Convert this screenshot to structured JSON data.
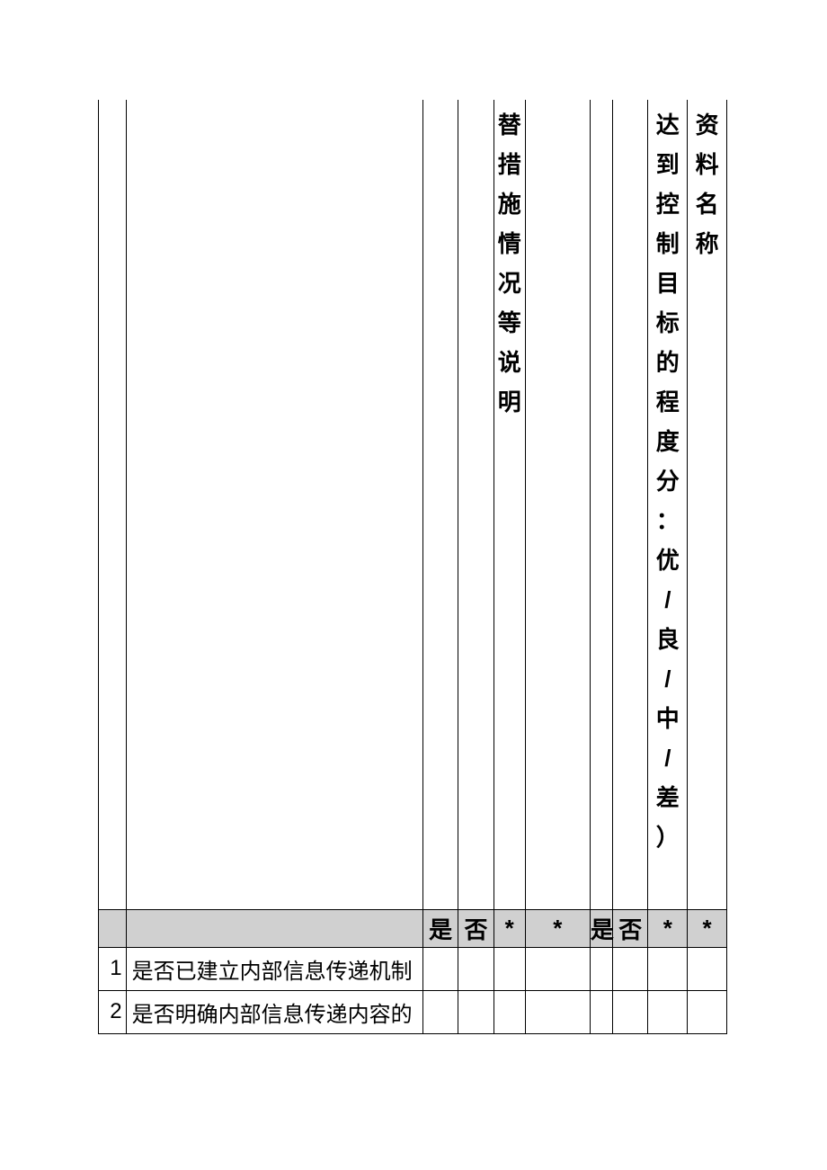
{
  "headers": {
    "verticalA": [
      "替",
      "措",
      "施",
      "情",
      "况",
      "等",
      "说",
      "明"
    ],
    "verticalB": [
      "达",
      "到",
      "控",
      "制",
      "目",
      "标",
      "的",
      "程",
      "度",
      "分",
      "：",
      "优",
      "/",
      "良",
      "/",
      "中",
      "/",
      "差",
      "）"
    ],
    "verticalC": [
      "资",
      "料",
      "名",
      "称"
    ]
  },
  "subheader": {
    "c3": "是",
    "c4": "否",
    "c5": "*",
    "c6": "*",
    "c7": "是",
    "c8": "否",
    "c9": "*",
    "c10": "*"
  },
  "rows": [
    {
      "num": "1",
      "text": "是否已建立内部信息传递机制"
    },
    {
      "num": "2",
      "text": "是否明确内部信息传递内容的"
    }
  ]
}
